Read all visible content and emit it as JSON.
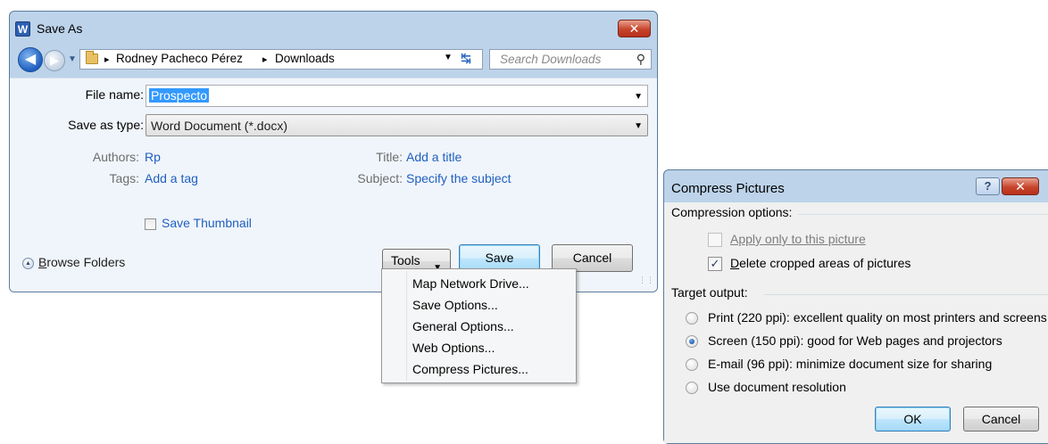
{
  "save_as": {
    "title": "Save As",
    "app_icon": "W",
    "close_glyph": "✕",
    "breadcrumb": [
      "Rodney Pacheco Pérez",
      "Downloads"
    ],
    "breadcrumb_separator": "▸",
    "search_placeholder": "Search Downloads",
    "file_name_label": "File name:",
    "file_name_value": "Prospecto",
    "save_as_type_label": "Save as type:",
    "save_as_type_value": "Word Document (*.docx)",
    "authors_label": "Authors:",
    "authors_value": "Rp",
    "tags_label": "Tags:",
    "tags_value": "Add a tag",
    "title_label": "Title:",
    "title_value": "Add a title",
    "subject_label": "Subject:",
    "subject_value": "Specify the subject",
    "save_thumbnail_label": "Save Thumbnail",
    "save_thumbnail_checked": false,
    "browse_folders_label": "Browse Folders",
    "tools_label": "Tools",
    "save_label": "Save",
    "cancel_label": "Cancel"
  },
  "tools_menu": {
    "items": [
      "Map Network Drive...",
      "Save Options...",
      "General Options...",
      "Web Options...",
      "Compress Pictures..."
    ]
  },
  "compress_pictures": {
    "title": "Compress Pictures",
    "help_glyph": "?",
    "close_glyph": "✕",
    "compression_options_header": "Compression options:",
    "apply_only_label": "Apply only to this picture",
    "apply_only_checked": false,
    "apply_only_enabled": false,
    "delete_cropped_label": "Delete cropped areas of pictures",
    "delete_cropped_checked": true,
    "check_glyph": "✓",
    "target_output_header": "Target output:",
    "options": [
      {
        "label": "Print (220 ppi): excellent quality on most printers and screens",
        "selected": false
      },
      {
        "label": "Screen (150 ppi): good for Web pages and projectors",
        "selected": true
      },
      {
        "label": "E-mail (96 ppi): minimize document size for sharing",
        "selected": false
      },
      {
        "label": "Use document resolution",
        "selected": false
      }
    ],
    "ok_label": "OK",
    "cancel_label": "Cancel"
  },
  "colors": {
    "link_blue": "#1f5fbf",
    "selection_blue": "#3399ff",
    "close_red": "#c7442c",
    "frame_blue": "#bcd3ea"
  }
}
